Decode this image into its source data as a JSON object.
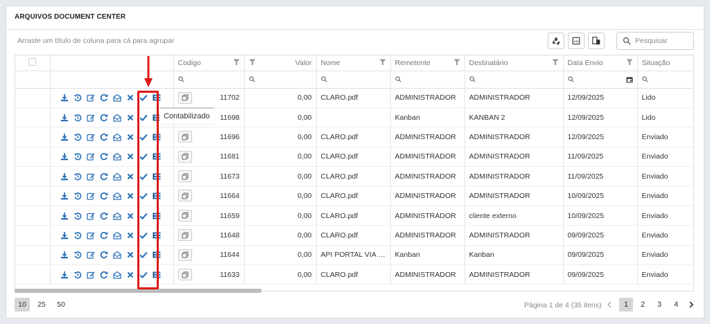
{
  "panel": {
    "title": "ARQUIVOS DOCUMENT CENTER"
  },
  "toolbar": {
    "group_hint": "Arraste um título de coluna para cá para agrupar",
    "search_placeholder": "Pesquisar"
  },
  "columns": [
    {
      "key": "codigo",
      "label": "Codigo"
    },
    {
      "key": "valor",
      "label": "Valor"
    },
    {
      "key": "nome",
      "label": "Nome"
    },
    {
      "key": "remetente",
      "label": "Remetente"
    },
    {
      "key": "destinatario",
      "label": "Destinatário"
    },
    {
      "key": "data_envio",
      "label": "Data Envio"
    },
    {
      "key": "situacao",
      "label": "Situação"
    }
  ],
  "rows": [
    {
      "codigo": "11702",
      "valor": "0,00",
      "nome": "CLARO.pdf",
      "remetente": "ADMINISTRADOR",
      "destinatario": "ADMINISTRADOR",
      "data_envio": "12/09/2025",
      "situacao": "Lido"
    },
    {
      "codigo": "11698",
      "valor": "0,00",
      "nome": "",
      "remetente": "Kanban",
      "destinatario": "KANBAN 2",
      "data_envio": "12/09/2025",
      "situacao": "Lido"
    },
    {
      "codigo": "11696",
      "valor": "0,00",
      "nome": "CLARO.pdf",
      "remetente": "ADMINISTRADOR",
      "destinatario": "ADMINISTRADOR",
      "data_envio": "12/09/2025",
      "situacao": "Enviado"
    },
    {
      "codigo": "11681",
      "valor": "0,00",
      "nome": "CLARO.pdf",
      "remetente": "ADMINISTRADOR",
      "destinatario": "ADMINISTRADOR",
      "data_envio": "11/09/2025",
      "situacao": "Enviado"
    },
    {
      "codigo": "11673",
      "valor": "0,00",
      "nome": "CLARO.pdf",
      "remetente": "ADMINISTRADOR",
      "destinatario": "ADMINISTRADOR",
      "data_envio": "11/09/2025",
      "situacao": "Enviado"
    },
    {
      "codigo": "11664",
      "valor": "0,00",
      "nome": "CLARO.pdf",
      "remetente": "ADMINISTRADOR",
      "destinatario": "ADMINISTRADOR",
      "data_envio": "10/09/2025",
      "situacao": "Enviado"
    },
    {
      "codigo": "11659",
      "valor": "0,00",
      "nome": "CLARO.pdf",
      "remetente": "ADMINISTRADOR",
      "destinatario": "cliente externo",
      "data_envio": "10/09/2025",
      "situacao": "Enviado"
    },
    {
      "codigo": "11648",
      "valor": "0,00",
      "nome": "CLARO.pdf",
      "remetente": "ADMINISTRADOR",
      "destinatario": "ADMINISTRADOR",
      "data_envio": "09/09/2025",
      "situacao": "Enviado"
    },
    {
      "codigo": "11644",
      "valor": "0,00",
      "nome": "API PORTAL VIA IM...",
      "remetente": "Kanban",
      "destinatario": "Kanban",
      "data_envio": "09/09/2025",
      "situacao": "Enviado"
    },
    {
      "codigo": "11633",
      "valor": "0,00",
      "nome": "CLARO.pdf",
      "remetente": "ADMINISTRADOR",
      "destinatario": "ADMINISTRADOR",
      "data_envio": "09/09/2025",
      "situacao": "Enviado"
    }
  ],
  "tooltip": {
    "text": "Contabilizado"
  },
  "pager": {
    "sizes": [
      "10",
      "25",
      "50"
    ],
    "info": "Página 1 de 4 (35 itens)",
    "pages": [
      "1",
      "2",
      "3",
      "4"
    ]
  },
  "colors": {
    "icon_blue": "#2e72b8",
    "highlight_red": "#e01818"
  }
}
